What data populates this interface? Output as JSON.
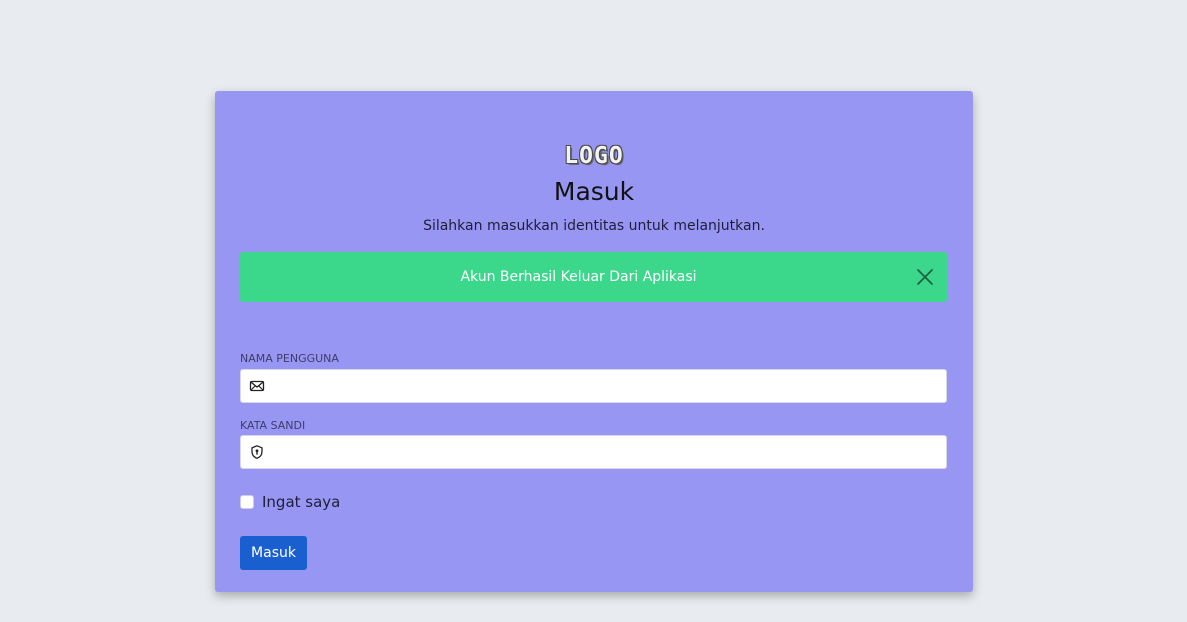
{
  "logo": "LOGO",
  "title": "Masuk",
  "subtitle": "Silahkan masukkan identitas untuk melanjutkan.",
  "alert": {
    "message": "Akun Berhasil Keluar Dari Aplikasi",
    "close_icon": "close-icon",
    "color": "#3bd88c"
  },
  "form": {
    "username_label": "NAMA PENGGUNA",
    "username_value": "",
    "username_icon": "envelope-icon",
    "password_label": "KATA SANDI",
    "password_value": "",
    "password_icon": "shield-icon",
    "remember_label": "Ingat saya",
    "remember_checked": false,
    "submit_label": "Masuk"
  },
  "colors": {
    "page_background": "#e8ebef",
    "card_background": "#9797f3",
    "button": "#1a5fd0"
  }
}
